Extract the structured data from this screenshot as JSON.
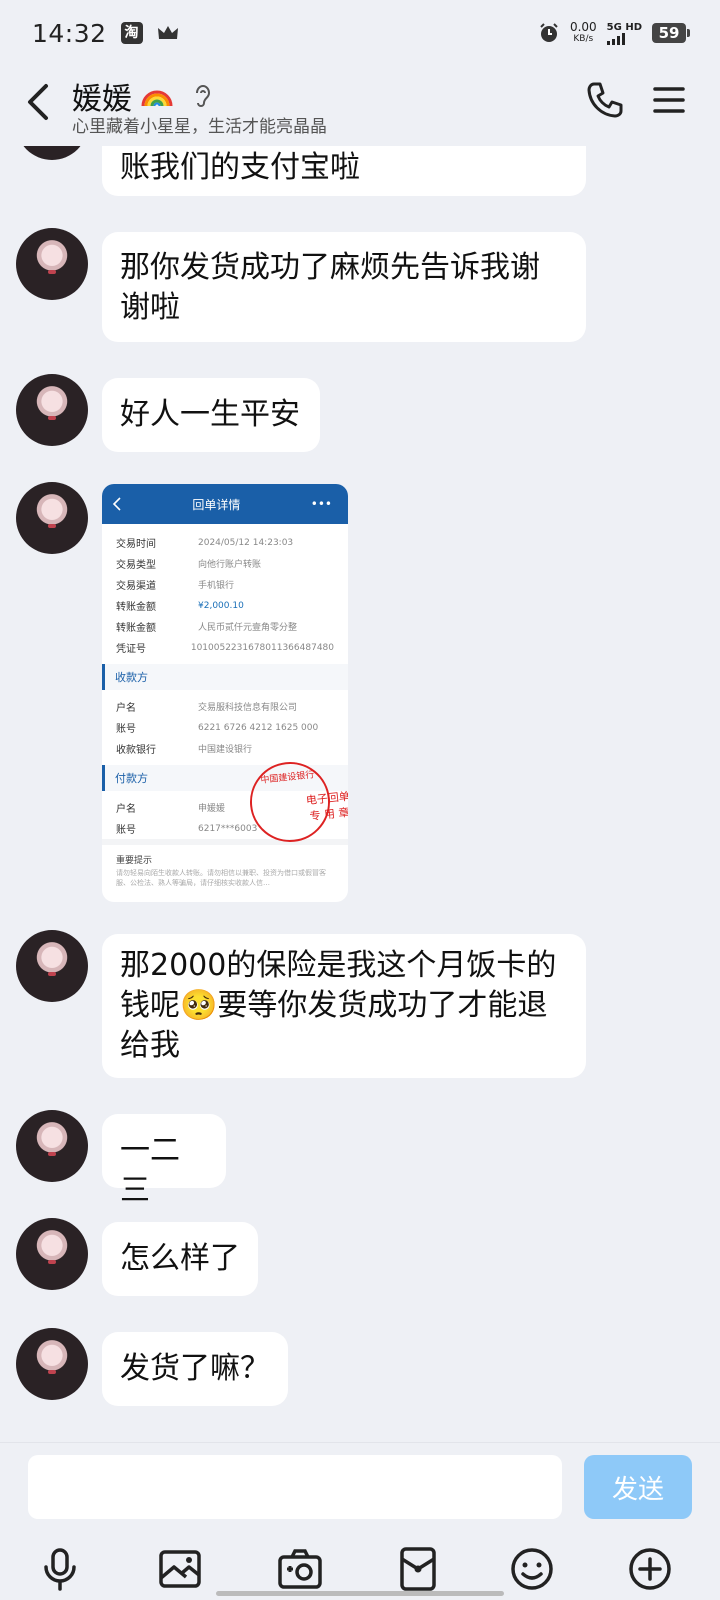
{
  "status_bar": {
    "time": "14:32",
    "net_speed_value": "0.00",
    "net_speed_unit": "KB/s",
    "signal_label": "5G HD",
    "battery": "59",
    "app_icon_text": "淘"
  },
  "header": {
    "contact_name": "媛媛",
    "signature": "心里藏着小星星，生活才能亮晶晶"
  },
  "messages": [
    {
      "text": "账我们的支付宝啦"
    },
    {
      "text": "那你发货成功了麻烦先告诉我谢谢啦"
    },
    {
      "text": "好人一生平安"
    },
    {
      "text": "那2000的保险是我这个月饭卡的钱呢🥺要等你发货成功了才能退给我"
    },
    {
      "text": "一二三"
    },
    {
      "text": "怎么样了"
    },
    {
      "text": "发货了嘛？"
    }
  ],
  "receipt": {
    "title": "回单详情",
    "more": "•••",
    "rows": [
      {
        "k": "交易时间",
        "v": "2024/05/12  14:23:03"
      },
      {
        "k": "交易类型",
        "v": "向他行账户转账"
      },
      {
        "k": "交易渠道",
        "v": "手机银行"
      },
      {
        "k": "转账金额",
        "v": "¥2,000.10"
      },
      {
        "k": "转账金额",
        "v": "人民币贰仟元壹角零分整"
      },
      {
        "k": "凭证号",
        "v": "1010052231678011366487480"
      }
    ],
    "payee_section": "收款方",
    "payee_rows": [
      {
        "k": "户名",
        "v": "交易服科技信息有限公司"
      },
      {
        "k": "账号",
        "v": "6221 6726 4212 1625 000"
      },
      {
        "k": "收款银行",
        "v": "中国建设银行"
      }
    ],
    "payer_section": "付款方",
    "payer_rows": [
      {
        "k": "户名",
        "v": "申媛媛"
      },
      {
        "k": "账号",
        "v": "6217***6003"
      }
    ],
    "note_title": "重要提示",
    "note_body": "请勿轻易向陌生收款人转账。请勿相信以兼职、投资为借口或假冒客服、公检法、熟人等骗局，请仔细核实收款人信…",
    "stamp_arc": "中国建设银行",
    "stamp_line1": "电子回单",
    "stamp_line2": "专 用 章"
  },
  "input": {
    "placeholder": "",
    "send_label": "发送"
  },
  "toolbar": {
    "icons": [
      "microphone-icon",
      "image-icon",
      "camera-icon",
      "red-packet-icon",
      "emoji-icon",
      "plus-icon"
    ]
  }
}
